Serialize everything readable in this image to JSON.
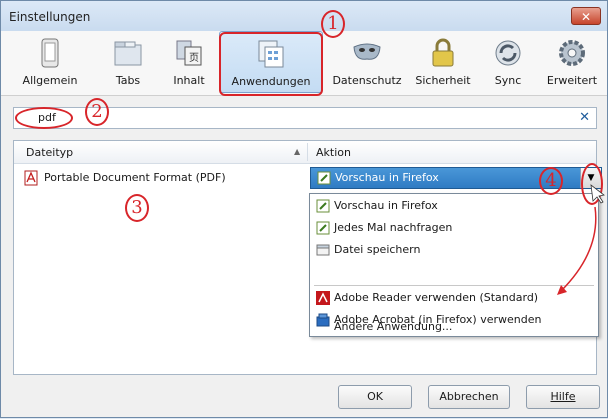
{
  "window": {
    "title": "Einstellungen",
    "close_label": "✕"
  },
  "toolbar": {
    "items": [
      {
        "label": "Allgemein",
        "icon": "phone-icon"
      },
      {
        "label": "Tabs",
        "icon": "folder-tabs-icon"
      },
      {
        "label": "Inhalt",
        "icon": "document-content-icon"
      },
      {
        "label": "Anwendungen",
        "icon": "applications-icon",
        "selected": true
      },
      {
        "label": "Datenschutz",
        "icon": "mask-icon"
      },
      {
        "label": "Sicherheit",
        "icon": "padlock-icon"
      },
      {
        "label": "Sync",
        "icon": "sync-icon"
      },
      {
        "label": "Erweitert",
        "icon": "gear-icon"
      }
    ]
  },
  "search": {
    "value": "pdf",
    "clear_label": "✕"
  },
  "table": {
    "columns": [
      "Dateityp",
      "Aktion"
    ],
    "sort_indicator": "▲",
    "rows": [
      {
        "type": "Portable Document Format (PDF)",
        "action": "Vorschau in Firefox"
      }
    ]
  },
  "dropdown": {
    "options": [
      {
        "label": "Vorschau in Firefox",
        "icon": "firefox-preview-icon"
      },
      {
        "label": "Jedes Mal nachfragen",
        "icon": "ask-icon"
      },
      {
        "label": "Datei speichern",
        "icon": "save-file-icon"
      },
      {
        "label": "Adobe Reader  verwenden (Standard)",
        "icon": "adobe-reader-icon"
      },
      {
        "label": "Adobe Acrobat (in Firefox) verwenden",
        "icon": "adobe-acrobat-icon"
      },
      {
        "label": "Andere Anwendung...",
        "icon": ""
      }
    ]
  },
  "buttons": {
    "ok": "OK",
    "cancel": "Abbrechen",
    "help": "Hilfe"
  },
  "annotations": {
    "n1": "1",
    "n2": "2",
    "n3": "3",
    "n4": "4"
  },
  "colors": {
    "annotation": "#d8252a",
    "selection": "#2f7bc3"
  }
}
